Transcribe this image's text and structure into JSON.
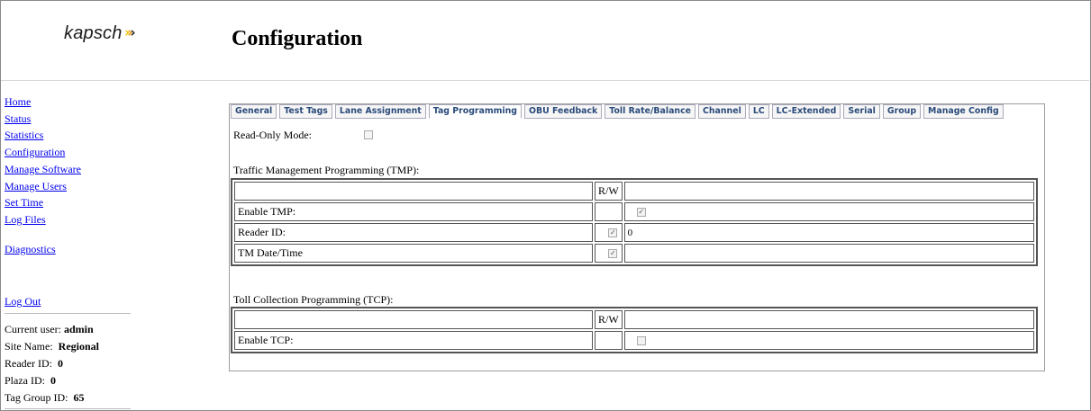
{
  "header": {
    "logo_text": "kapsch",
    "page_title": "Configuration"
  },
  "nav": {
    "items": [
      "Home",
      "Status",
      "Statistics",
      "Configuration",
      "Manage Software",
      "Manage Users",
      "Set Time",
      "Log Files"
    ],
    "diagnostics": "Diagnostics",
    "logout": "Log Out"
  },
  "info": {
    "current_user_label": "Current user:",
    "current_user": "admin",
    "site_name_label": "Site Name:",
    "site_name": "Regional",
    "reader_id_label": "Reader ID:",
    "reader_id": "0",
    "plaza_id_label": "Plaza ID:",
    "plaza_id": "0",
    "tag_group_id_label": "Tag Group ID:",
    "tag_group_id": "65"
  },
  "tabs": [
    "General",
    "Test Tags",
    "Lane Assignment",
    "Tag Programming",
    "OBU Feedback",
    "Toll Rate/Balance",
    "Channel",
    "LC",
    "LC-Extended",
    "Serial",
    "Group",
    "Manage Config"
  ],
  "active_tab": "Tag Programming",
  "readonly": {
    "label": "Read-Only Mode:",
    "checked": false
  },
  "tmp": {
    "title": "Traffic Management Programming (TMP):",
    "rw_header": "R/W",
    "rows": [
      {
        "label": "Enable TMP:",
        "rw": null,
        "value_type": "checkbox",
        "value_checked": true
      },
      {
        "label": "Reader ID:",
        "rw": true,
        "value_type": "text",
        "value": "0"
      },
      {
        "label": "TM Date/Time",
        "rw": true,
        "value_type": "empty"
      }
    ]
  },
  "tcp": {
    "title": "Toll Collection Programming (TCP):",
    "rw_header": "R/W",
    "rows": [
      {
        "label": "Enable TCP:",
        "rw": null,
        "value_type": "checkbox",
        "value_checked": false
      }
    ]
  }
}
